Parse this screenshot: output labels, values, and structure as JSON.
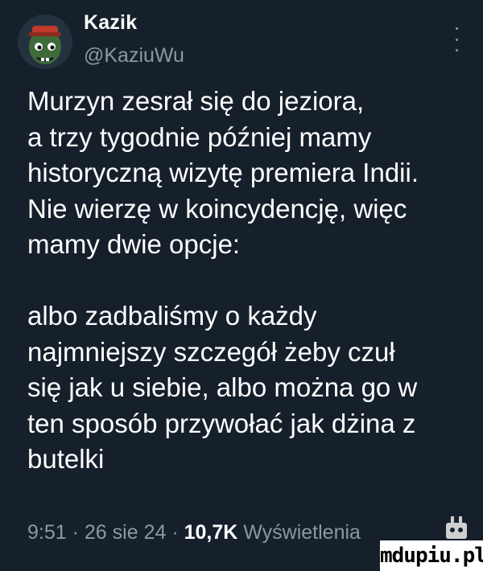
{
  "author": {
    "name": "Kazik",
    "handle": "@KaziuWu"
  },
  "tweet": {
    "lines_para1": [
      "Murzyn zesrał się do jeziora,",
      "a trzy tygodnie później mamy",
      "historyczną wizytę premiera Indii.",
      "Nie wierzę w koincydencję, więc",
      "mamy dwie opcje:"
    ],
    "lines_para2": [
      "albo zadbaliśmy o każdy",
      "najmniejszy szczegół żeby czuł",
      "się jak u siebie, albo można go w",
      "ten sposób przywołać jak dżina z",
      "butelki"
    ]
  },
  "meta": {
    "time": "9:51",
    "separator": "·",
    "date": "26 sie 24",
    "views_count": "10,7K",
    "views_label": "Wyświetlenia"
  },
  "icons": {
    "more": "more-vertical-icon"
  },
  "colors": {
    "background": "#16202b",
    "text": "#ffffff",
    "secondary_text": "#8b98a5"
  },
  "watermark": {
    "text": "mdupiu.pl"
  }
}
